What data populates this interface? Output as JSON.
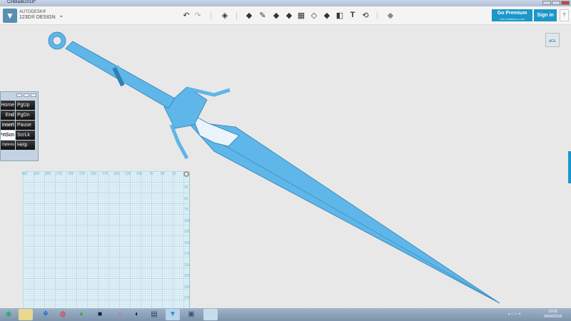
{
  "window": {
    "title": "CiriBlade2018*"
  },
  "app": {
    "brand_top": "AUTODESK®",
    "brand_name": "123D® DESIGN"
  },
  "toolbar": {
    "undo": "↶",
    "redo": "↷",
    "tools": [
      "transform",
      "primitives",
      "sketch",
      "construct",
      "modify",
      "pattern",
      "grouping",
      "combine",
      "measure",
      "text",
      "snap",
      "material"
    ],
    "text_tool": "T"
  },
  "account": {
    "premium_label": "Go Premium",
    "premium_sub": "FOR COMMERCIAL USE",
    "signin_label": "Sign in",
    "help_label": "?"
  },
  "viewcube": {
    "label": "TOP"
  },
  "osk": {
    "keys": [
      [
        "Home",
        "PgUp"
      ],
      [
        "End",
        "PgDn"
      ],
      [
        "Insert",
        "Pause"
      ],
      [
        "PrtScn",
        "ScrLk"
      ],
      [
        "Options",
        "Help"
      ]
    ],
    "visible": [
      [
        "Home",
        "PgUp"
      ],
      [
        "nd",
        "PgDn"
      ],
      [
        "nsert",
        "Pause"
      ],
      [
        "rtScn",
        "ScrLk"
      ],
      [
        "Options",
        "Help"
      ]
    ]
  },
  "ruler": {
    "x_labels": [
      "350",
      "325",
      "300",
      "275",
      "250",
      "225",
      "200",
      "175",
      "150",
      "125",
      "100",
      "75",
      "50",
      "25"
    ],
    "y_labels": [
      "25",
      "50",
      "75",
      "100",
      "125",
      "150",
      "175",
      "200",
      "225",
      "250",
      "275"
    ]
  },
  "taskbar": {
    "apps": [
      "start",
      "explorer",
      "dropbox",
      "chrome",
      "app",
      "app2",
      "itunes",
      "steam",
      "app3",
      "123d-design",
      "app4",
      "app5"
    ]
  },
  "clock": {
    "time": "19:05",
    "date": "09/04/2018"
  },
  "colors": {
    "accent": "#1b97c9",
    "model": "#5fb6e8"
  }
}
